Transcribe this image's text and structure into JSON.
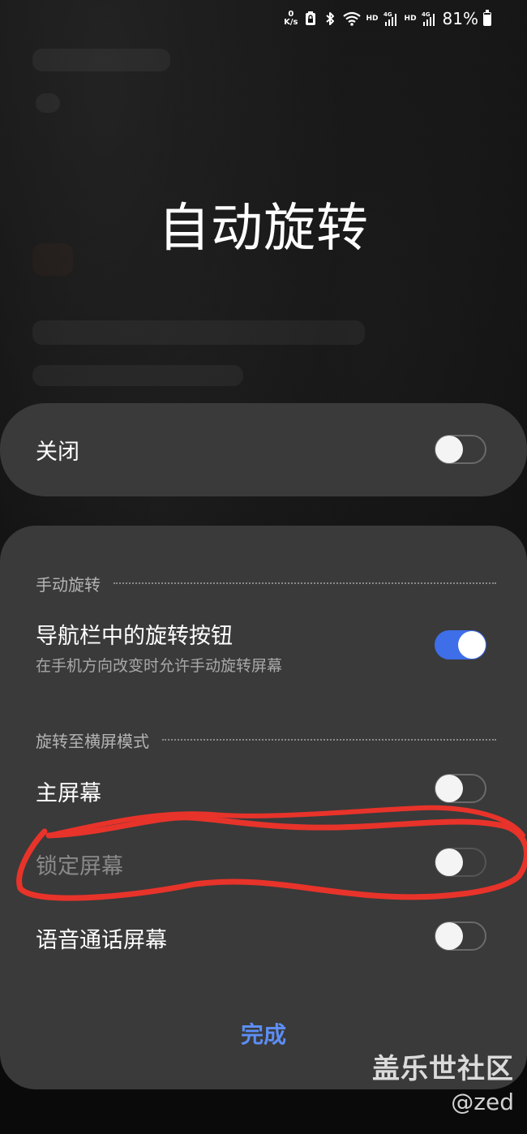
{
  "status_bar": {
    "speed_value": "0",
    "speed_unit": "K/s",
    "network1": "HD",
    "network1_gen": "4G",
    "network2": "HD",
    "network2_gen": "4G",
    "battery_percent": "81%",
    "battery_level": 0.81,
    "icons": [
      "net-speed-icon",
      "lock-battery-icon",
      "bluetooth-icon",
      "wifi-icon",
      "signal-icon",
      "signal-icon",
      "battery-icon"
    ]
  },
  "page": {
    "title": "自动旋转"
  },
  "master_toggle": {
    "label": "关闭",
    "state": "off"
  },
  "sections": {
    "manual": {
      "header": "手动旋转",
      "nav_button": {
        "title": "导航栏中的旋转按钮",
        "subtitle": "在手机方向改变时允许手动旋转屏幕",
        "state": "on"
      }
    },
    "landscape": {
      "header": "旋转至横屏模式",
      "home": {
        "title": "主屏幕",
        "state": "off"
      },
      "lock": {
        "title": "锁定屏幕",
        "state": "off",
        "disabled": true
      },
      "voice_call": {
        "title": "语音通话屏幕",
        "state": "off"
      }
    }
  },
  "done_label": "完成",
  "colors": {
    "accent": "#3e6ee8",
    "done_text": "#5c8ef5",
    "card": "#3a3a3a",
    "annotation": "#e8332a"
  },
  "watermark": {
    "site": "盖乐世社区",
    "user": "@zed"
  }
}
